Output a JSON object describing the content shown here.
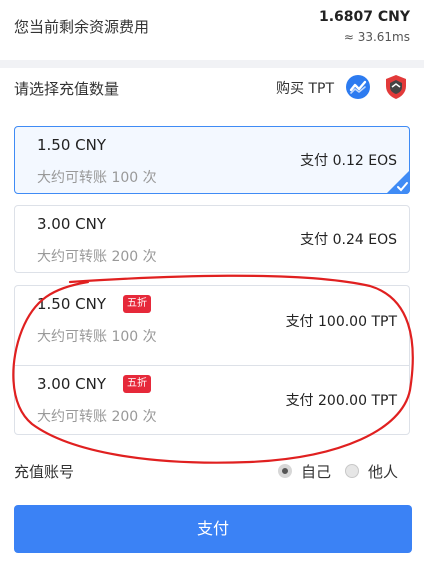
{
  "balance": {
    "label": "您当前剩余资源费用",
    "value": "1.6807 CNY",
    "sub": "≈ 33.61ms"
  },
  "recharge": {
    "select_label": "请选择充值数量",
    "buy_label": "购买 TPT",
    "icons": [
      "chart-wave-icon",
      "shield-icon"
    ],
    "accent_color": "#3b82f5"
  },
  "options": [
    {
      "amount": "1.50 CNY",
      "desc": "大约可转账 100 次",
      "pay": "支付 0.12 EOS",
      "selected": true
    },
    {
      "amount": "3.00 CNY",
      "desc": "大约可转账 200 次",
      "pay": "支付 0.24 EOS"
    },
    {
      "amount": "1.50 CNY",
      "badge": "五折",
      "desc": "大约可转账 100 次",
      "pay": "支付 100.00 TPT"
    },
    {
      "amount": "3.00 CNY",
      "badge": "五折",
      "desc": "大约可转账 200 次",
      "pay": "支付 200.00 TPT"
    }
  ],
  "account": {
    "label": "充值账号",
    "self": "自己",
    "other": "他人",
    "selected": "self"
  },
  "pay_button": "支付"
}
